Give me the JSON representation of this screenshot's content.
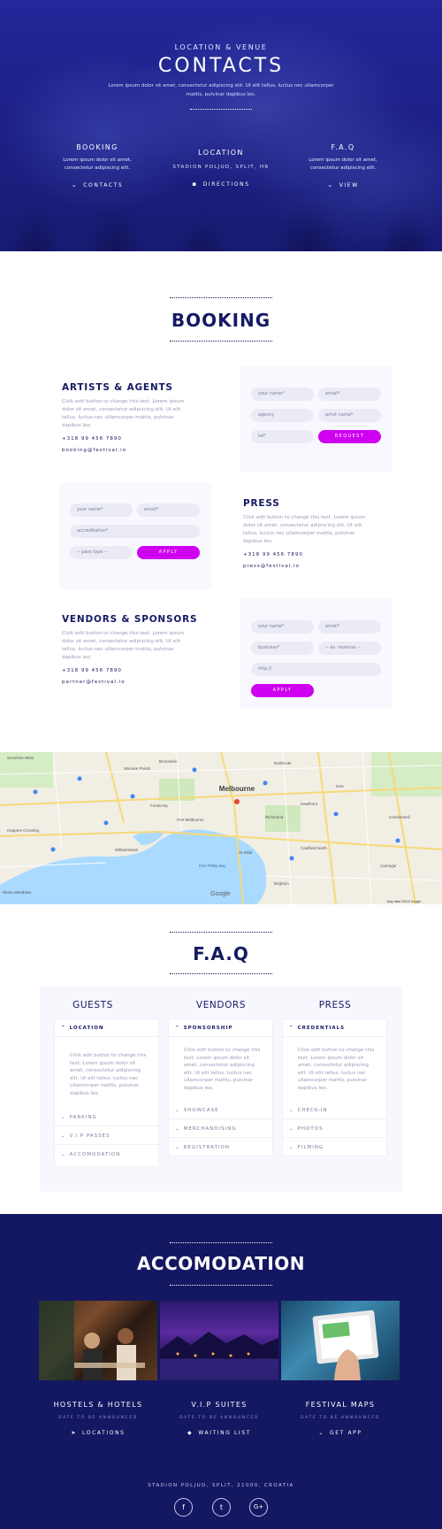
{
  "hero": {
    "pre": "LOCATION & VENUE",
    "title": "CONTACTS",
    "subtitle": "Lorem ipsum dolor sit amet, consectetur adipiscing elit. Ut elit tellus, luctus nec ullamcorper mattis, pulvinar dapibus leo.",
    "columns": [
      {
        "title": "BOOKING",
        "text": "Lorem ipsum dolor sit amet, consectetur adipiscing elit.",
        "link": "CONTACTS",
        "icon": "chevron-down-icon"
      },
      {
        "title": "LOCATION",
        "text": "STADION POLJUD, SPLIT, HR",
        "link": "DIRECTIONS",
        "icon": "book-icon"
      },
      {
        "title": "F.A.Q",
        "text": "Lorem ipsum dolor sit amet, consectetur adipiscing elit.",
        "link": "VIEW",
        "icon": "chevron-down-icon"
      }
    ]
  },
  "booking": {
    "title": "BOOKING",
    "artists": {
      "title": "ARTISTS & AGENTS",
      "text": "Click edit button to change this text. Lorem ipsum dolor sit amet, consectetur adipiscing elit. Ut elit tellus, luctus nec ullamcorper mattis, pulvinar dapibus leo.",
      "phone": "+318 99 456 7890",
      "email": "booking@festival.io",
      "fields": {
        "name": "your name*",
        "email": "email*",
        "agency": "agency",
        "artist": "artist name*",
        "tel": "tel*"
      },
      "button": "REQUEST"
    },
    "press": {
      "title": "PRESS",
      "text": "Click edit button to change this text. Lorem ipsum dolor sit amet, consectetur adipiscing elit. Ut elit tellus, luctus nec ullamcorper mattis, pulvinar dapibus leo.",
      "phone": "+318 99 456 7890",
      "email": "press@festival.io",
      "fields": {
        "name": "your name*",
        "email": "email*",
        "accreditation": "accreditation*",
        "pass": "-- pass type --"
      },
      "button": "APPLY"
    },
    "vendors": {
      "title": "VENDORS & SPONSORS",
      "text": "Click edit button to change this text. Lorem ipsum dolor sit amet, consectetur adipiscing elit. Ut elit tellus, luctus nec ullamcorper mattis, pulvinar dapibus leo.",
      "phone": "+318 99 456 7890",
      "email": "partner@festival.io",
      "fields": {
        "name": "your name*",
        "email": "email*",
        "business": "business*",
        "revenue": "-- av. revenue --",
        "http": "http://"
      },
      "button": "APPLY"
    }
  },
  "map": {
    "city": "Melbourne",
    "labels": [
      "Sunshine West",
      "Moonee Ponds",
      "Brunswick",
      "Northcote",
      "Kew",
      "Hawthorn",
      "Richmond",
      "Footscray",
      "Williamstown",
      "Port Melbourne",
      "St Kilda",
      "Caulfield North",
      "Brighton",
      "Hoppers Crossing",
      "Altona Meadows",
      "Port Phillip Bay",
      "Camberwell",
      "Carnegie"
    ],
    "brand": "Google",
    "credit": "Map data ©2019 Google"
  },
  "faq": {
    "title": "F.A.Q",
    "columns": [
      {
        "head": "GUESTS",
        "open": "LOCATION",
        "body": "Click edit button to change this text. Lorem ipsum dolor sit amet, consectetur adipiscing elit. Ut elit tellus, luctus nec ullamcorper mattis, pulvinar dapibus leo.",
        "items": [
          "PARKING",
          "V.I.P PASSES",
          "ACCOMODATION"
        ]
      },
      {
        "head": "VENDORS",
        "open": "SPONSORSHIP",
        "body": "Click edit button to change this text. Lorem ipsum dolor sit amet, consectetur adipiscing elit. Ut elit tellus, luctus nec ullamcorper mattis, pulvinar dapibus leo.",
        "items": [
          "SHOWCASE",
          "MERCHANDISING",
          "REGISTRATION"
        ]
      },
      {
        "head": "PRESS",
        "open": "CREDENTIALS",
        "body": "Click edit button to change this text. Lorem ipsum dolor sit amet, consectetur adipiscing elit. Ut elit tellus, luctus nec ullamcorper mattis, pulvinar dapibus leo.",
        "items": [
          "CHECK-IN",
          "PHOTOS",
          "FILMING"
        ]
      }
    ]
  },
  "accomodation": {
    "title": "ACCOMODATION",
    "cards": [
      {
        "title": "HOSTELS & HOTELS",
        "sub": "DATE TO BE ANNOUNCED",
        "link": "LOCATIONS",
        "icon": "location-arrow-icon"
      },
      {
        "title": "V.I.P SUITES",
        "sub": "DATE TO BE ANNOUNCED",
        "link": "WAITING LIST",
        "icon": "diamond-icon"
      },
      {
        "title": "FESTIVAL MAPS",
        "sub": "DATE TO BE ANNOUNCED",
        "link": "GET APP",
        "icon": "chevron-down-icon"
      }
    ],
    "address": "STADION POLJUD, SPLIT, 21000, CROATIA",
    "social": [
      "f",
      "t",
      "G+"
    ]
  },
  "colors": {
    "navy": "#141a63",
    "hero": "#1c2080",
    "accent": "#cf00f0",
    "muted": "#9a9ab8"
  }
}
